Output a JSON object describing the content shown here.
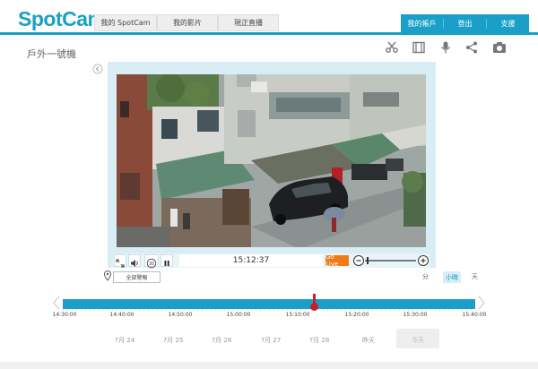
{
  "app": {
    "logo": "SpotCam"
  },
  "nav": {
    "tabs": [
      "我的 SpotCam",
      "我的影片",
      "現正直播"
    ]
  },
  "account_nav": {
    "items": [
      "我的帳戶",
      "登出",
      "支援"
    ]
  },
  "camera": {
    "name": "戶外一號機"
  },
  "toolbar_icons": [
    "scissors-icon",
    "film-icon",
    "mic-icon",
    "share-icon",
    "camera-icon"
  ],
  "player": {
    "time": "15:12:37",
    "go_live_label": "Go Live"
  },
  "filter": {
    "label": "全部警報"
  },
  "scale": {
    "minute": "分",
    "hour": "小時",
    "day": "天",
    "selected": "小時"
  },
  "timeline": {
    "ticks": [
      "14:30:00",
      "14:40:00",
      "14:50:00",
      "15:00:00",
      "15:10:00",
      "15:20:00",
      "15:30:00",
      "15:40:00"
    ],
    "current": "15:12:37"
  },
  "dates": [
    "7月 24",
    "7月 25",
    "7月 26",
    "7月 27",
    "7月 28",
    "昨天",
    "今天"
  ],
  "colors": {
    "accent": "#1aa0c8",
    "live": "#ef7a16",
    "marker": "#c8202a"
  }
}
